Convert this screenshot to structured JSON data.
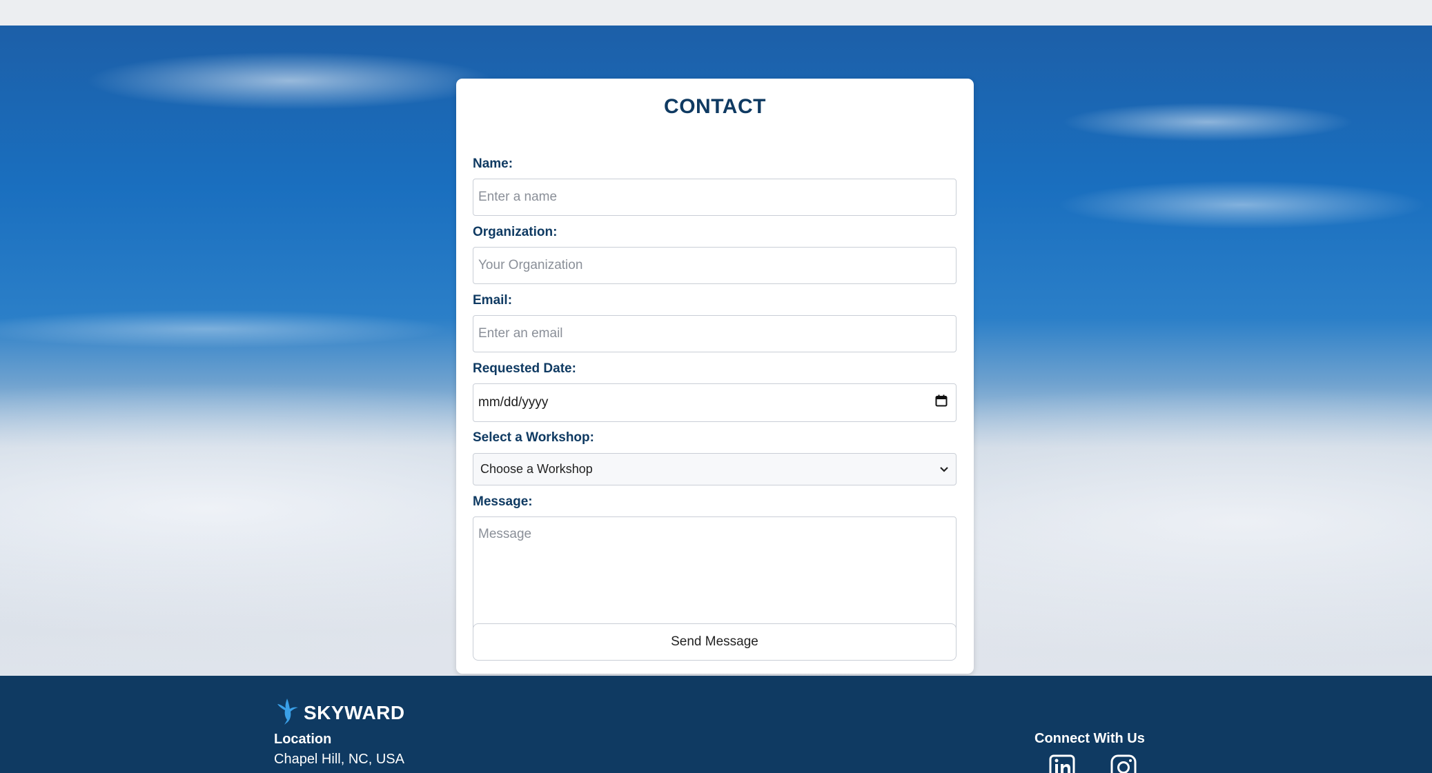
{
  "contact": {
    "title": "CONTACT",
    "name_label": "Name:",
    "name_placeholder": "Enter a name",
    "organization_label": "Organization:",
    "organization_placeholder": "Your Organization",
    "email_label": "Email:",
    "email_placeholder": "Enter an email",
    "date_label": "Requested Date:",
    "date_value": "mm/dd/yyyy",
    "workshop_label": "Select a Workshop:",
    "workshop_selected": "Choose a Workshop",
    "message_label": "Message:",
    "message_placeholder": "Message",
    "send_label": "Send Message"
  },
  "footer": {
    "brand": "SKYWARD",
    "location_title": "Location",
    "location_value": "Chapel Hill, NC, USA",
    "connect_title": "Connect With Us",
    "social": [
      "linkedin-icon",
      "instagram-icon"
    ]
  },
  "colors": {
    "primary": "#0f3a62",
    "brand_accent": "#3aa0e8",
    "card_bg": "#ffffff"
  }
}
